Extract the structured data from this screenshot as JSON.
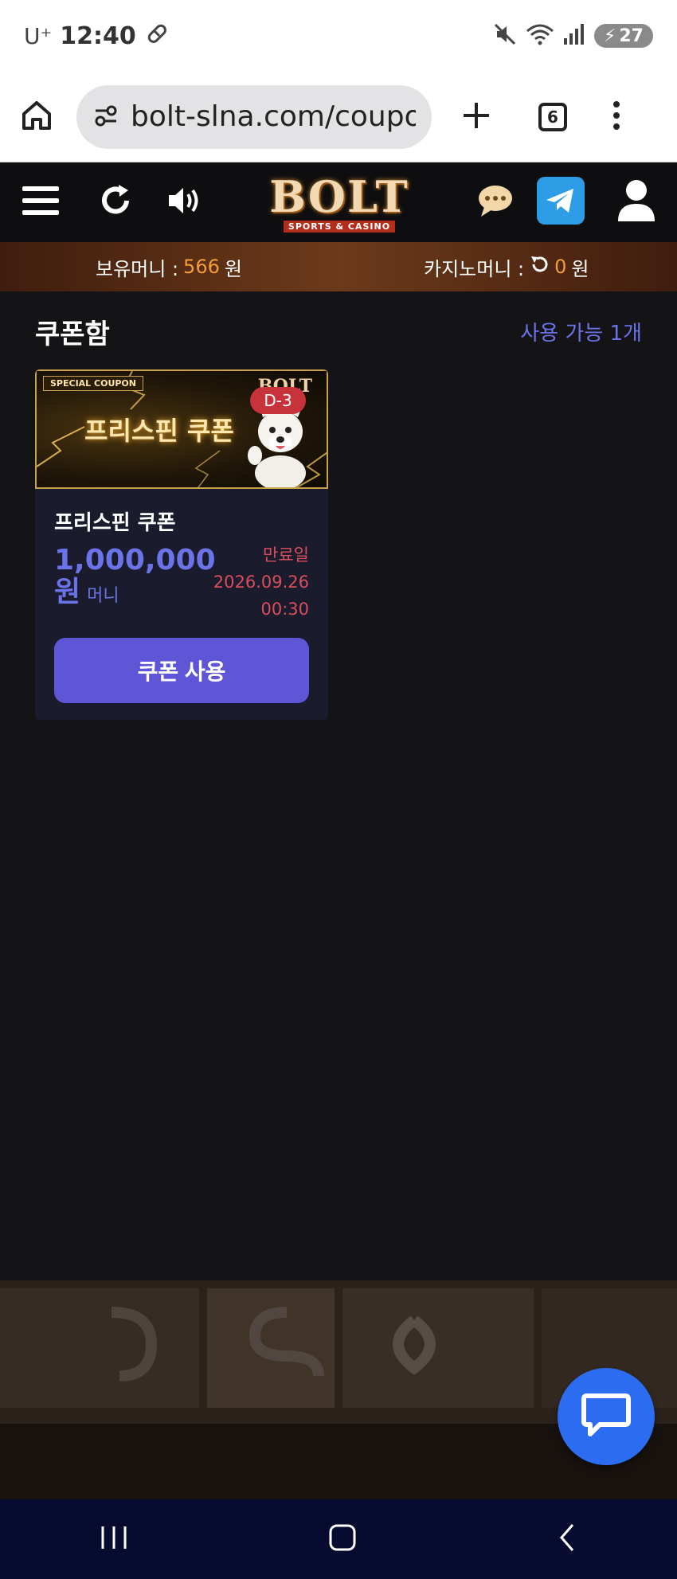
{
  "status_bar": {
    "carrier": "U⁺",
    "time": "12:40",
    "battery": "27"
  },
  "browser": {
    "url": "bolt-slna.com/coupon",
    "tab_count": "6"
  },
  "site": {
    "logo": "BOLT",
    "logo_sub": "SPORTS & CASINO"
  },
  "balance": {
    "money_label": "보유머니 :",
    "money_value": "566",
    "money_unit": "원",
    "casino_label": "카지노머니 :",
    "casino_value": "0",
    "casino_unit": "원"
  },
  "coupons": {
    "title": "쿠폰함",
    "available": "사용 가능 1개",
    "items": [
      {
        "banner_tag": "SPECIAL COUPON",
        "banner_title": "프리스핀 쿠폰",
        "banner_logo": "BOLT",
        "dday": "D-3",
        "name": "프리스핀 쿠폰",
        "amount": "1,000,000",
        "amount_unit": "원",
        "amount_type": "머니",
        "expire_label": "만료일",
        "expire_date": "2026.09.26",
        "expire_time": "00:30",
        "button": "쿠폰 사용"
      }
    ]
  },
  "colors": {
    "accent": "#5e56d6",
    "accent_text": "#6b73e8",
    "expire": "#d94e5c",
    "balance_value": "#f39c3a",
    "chat_fab": "#2b6cf0"
  }
}
